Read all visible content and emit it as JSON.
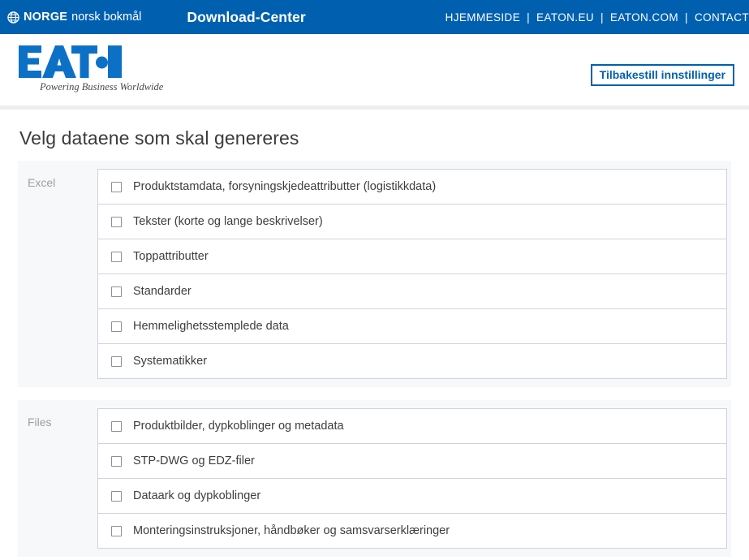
{
  "topbar": {
    "globe_icon": "globe-icon",
    "country": "NORGE",
    "language": "norsk bokmål",
    "site_title": "Download-Center",
    "separator": "|",
    "nav": [
      {
        "label": "HJEMMESIDE"
      },
      {
        "label": "EATON.EU"
      },
      {
        "label": "EATON.COM"
      },
      {
        "label": "CONTACT"
      }
    ]
  },
  "brand": {
    "logo_text": "EAT·N",
    "tagline": "Powering Business Worldwide",
    "reset_button": "Tilbakestill innstillinger",
    "brand_blue": "#0060B0",
    "logo_blue": "#0C71C6"
  },
  "main": {
    "page_title": "Velg dataene som skal genereres",
    "sections": [
      {
        "label": "Excel",
        "items": [
          {
            "label": "Produktstamdata, forsyningskjedeattributter (logistikkdata)",
            "checked": false
          },
          {
            "label": "Tekster (korte og lange beskrivelser)",
            "checked": false
          },
          {
            "label": "Toppattributter",
            "checked": false
          },
          {
            "label": "Standarder",
            "checked": false
          },
          {
            "label": "Hemmelighetsstemplede data",
            "checked": false
          },
          {
            "label": "Systematikker",
            "checked": false
          }
        ]
      },
      {
        "label": "Files",
        "items": [
          {
            "label": "Produktbilder, dypkoblinger og metadata",
            "checked": false
          },
          {
            "label": "STP-DWG og EDZ-filer",
            "checked": false
          },
          {
            "label": "Dataark og dypkoblinger",
            "checked": false
          },
          {
            "label": "Monteringsinstruksjoner, håndbøker og samsvarserklæringer",
            "checked": false
          }
        ]
      }
    ]
  }
}
